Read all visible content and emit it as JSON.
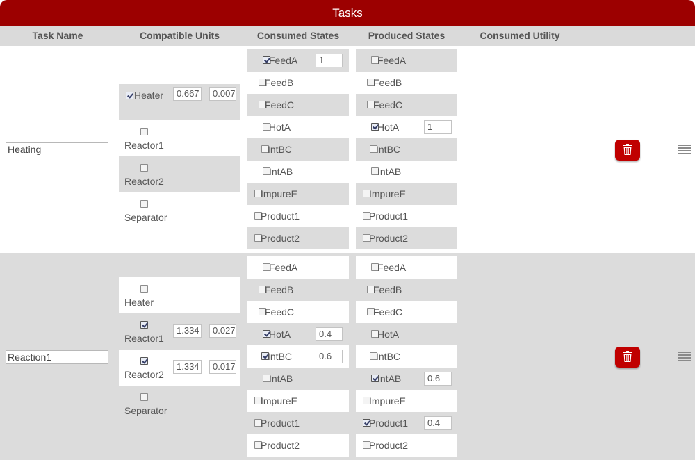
{
  "title": "Tasks",
  "headers": [
    "Task Name",
    "Compatible Units",
    "Consumed States",
    "Produced States",
    "Consumed Utility"
  ],
  "colors": {
    "accent": "#9c0000",
    "delete_button": "#c00000",
    "shade": "#dcdcdc"
  },
  "tasks": [
    {
      "name": "Heating",
      "units": [
        {
          "label": "Heater",
          "checked": true,
          "values": [
            "0.667",
            "0.007"
          ]
        },
        {
          "label": "Reactor1",
          "checked": false,
          "values": []
        },
        {
          "label": "Reactor2",
          "checked": false,
          "values": []
        },
        {
          "label": "Separator",
          "checked": false,
          "values": []
        }
      ],
      "consumed": [
        {
          "label": "FeedA",
          "checked": true,
          "value": "1"
        },
        {
          "label": "FeedB",
          "checked": false,
          "value": ""
        },
        {
          "label": "FeedC",
          "checked": false,
          "value": ""
        },
        {
          "label": "HotA",
          "checked": false,
          "value": ""
        },
        {
          "label": "IntBC",
          "checked": false,
          "value": ""
        },
        {
          "label": "IntAB",
          "checked": false,
          "value": ""
        },
        {
          "label": "ImpureE",
          "checked": false,
          "value": ""
        },
        {
          "label": "Product1",
          "checked": false,
          "value": ""
        },
        {
          "label": "Product2",
          "checked": false,
          "value": ""
        }
      ],
      "produced": [
        {
          "label": "FeedA",
          "checked": false,
          "value": ""
        },
        {
          "label": "FeedB",
          "checked": false,
          "value": ""
        },
        {
          "label": "FeedC",
          "checked": false,
          "value": ""
        },
        {
          "label": "HotA",
          "checked": true,
          "value": "1"
        },
        {
          "label": "IntBC",
          "checked": false,
          "value": ""
        },
        {
          "label": "IntAB",
          "checked": false,
          "value": ""
        },
        {
          "label": "ImpureE",
          "checked": false,
          "value": ""
        },
        {
          "label": "Product1",
          "checked": false,
          "value": ""
        },
        {
          "label": "Product2",
          "checked": false,
          "value": ""
        }
      ],
      "delete_icon": "trash-icon",
      "drag_icon": "drag-handle-icon"
    },
    {
      "name": "Reaction1",
      "units": [
        {
          "label": "Heater",
          "checked": false,
          "values": []
        },
        {
          "label": "Reactor1",
          "checked": true,
          "values": [
            "1.334",
            "0.027"
          ]
        },
        {
          "label": "Reactor2",
          "checked": true,
          "values": [
            "1.334",
            "0.017"
          ]
        },
        {
          "label": "Separator",
          "checked": false,
          "values": []
        }
      ],
      "consumed": [
        {
          "label": "FeedA",
          "checked": false,
          "value": ""
        },
        {
          "label": "FeedB",
          "checked": false,
          "value": ""
        },
        {
          "label": "FeedC",
          "checked": false,
          "value": ""
        },
        {
          "label": "HotA",
          "checked": true,
          "value": "0.4"
        },
        {
          "label": "IntBC",
          "checked": true,
          "value": "0.6"
        },
        {
          "label": "IntAB",
          "checked": false,
          "value": ""
        },
        {
          "label": "ImpureE",
          "checked": false,
          "value": ""
        },
        {
          "label": "Product1",
          "checked": false,
          "value": ""
        },
        {
          "label": "Product2",
          "checked": false,
          "value": ""
        }
      ],
      "produced": [
        {
          "label": "FeedA",
          "checked": false,
          "value": ""
        },
        {
          "label": "FeedB",
          "checked": false,
          "value": ""
        },
        {
          "label": "FeedC",
          "checked": false,
          "value": ""
        },
        {
          "label": "HotA",
          "checked": false,
          "value": ""
        },
        {
          "label": "IntBC",
          "checked": false,
          "value": ""
        },
        {
          "label": "IntAB",
          "checked": true,
          "value": "0.6"
        },
        {
          "label": "ImpureE",
          "checked": false,
          "value": ""
        },
        {
          "label": "Product1",
          "checked": true,
          "value": "0.4"
        },
        {
          "label": "Product2",
          "checked": false,
          "value": ""
        }
      ],
      "delete_icon": "trash-icon",
      "drag_icon": "drag-handle-icon"
    }
  ]
}
